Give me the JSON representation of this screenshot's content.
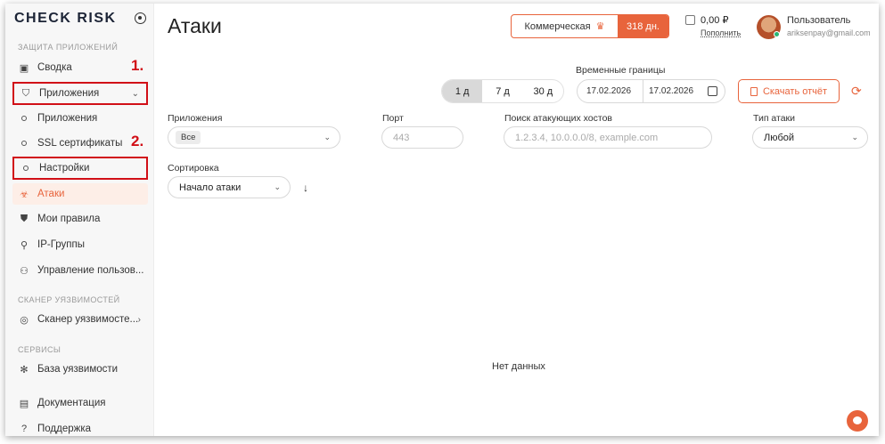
{
  "sidebar": {
    "logo": "CHECK RISK",
    "sections": {
      "apps": "ЗАЩИТА ПРИЛОЖЕНИЙ",
      "scanner": "СКАНЕР УЯЗВИМОСТЕЙ",
      "services": "СЕРВИСЫ"
    },
    "items": {
      "overview": "Сводка",
      "apps_group": "Приложения",
      "apps_list": "Приложения",
      "ssl": "SSL сертификаты",
      "settings": "Настройки",
      "attacks": "Атаки",
      "rules": "Мои правила",
      "ip_groups": "IP-Группы",
      "users": "Управление пользов...",
      "scanner": "Сканер уязвимосте...",
      "vuln_db": "База уязвимости",
      "docs": "Документация",
      "support": "Поддержка"
    },
    "markers": {
      "one": "1.",
      "two": "2."
    }
  },
  "header": {
    "title": "Атаки",
    "plan_name": "Коммерческая",
    "plan_days": "318 дн.",
    "balance": "0,00 ₽",
    "topup": "Пополнить",
    "user_name": "Пользователь",
    "user_email": "ariksenpay@gmail.com"
  },
  "filters": {
    "range_label": "Временные границы",
    "periods": [
      "1 д",
      "7 д",
      "30 д"
    ],
    "date_from": "17.02.2026",
    "date_to": "17.02.2026",
    "download": "Скачать отчёт",
    "apps_label": "Приложения",
    "apps_value": "Все",
    "port_label": "Порт",
    "port_placeholder": "443",
    "hosts_label": "Поиск атакующих хостов",
    "hosts_placeholder": "1.2.3.4, 10.0.0.0/8, example.com",
    "attack_type_label": "Тип атаки",
    "attack_type_value": "Любой",
    "sort_label": "Сортировка",
    "sort_value": "Начало атаки"
  },
  "content": {
    "empty": "Нет данных"
  },
  "colors": {
    "accent": "#e8643c",
    "annotation": "#d10f17"
  }
}
